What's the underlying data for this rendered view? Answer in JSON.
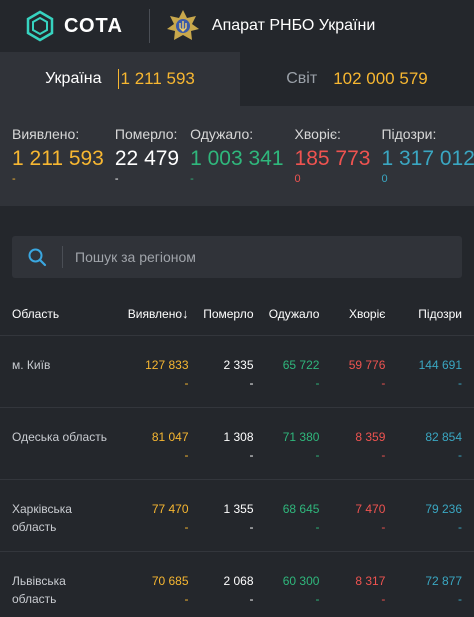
{
  "header": {
    "logo_text": "СОТА",
    "org_name": "Апарат РНБО України"
  },
  "tabs": [
    {
      "label": "Україна",
      "value": "1 211 593"
    },
    {
      "label": "Світ",
      "value": "102 000 579"
    }
  ],
  "summary": [
    {
      "label": "Виявлено:",
      "value": "1 211 593",
      "delta": "-"
    },
    {
      "label": "Померло:",
      "value": "22 479",
      "delta": "-"
    },
    {
      "label": "Одужало:",
      "value": "1 003 341",
      "delta": "-"
    },
    {
      "label": "Хворіє:",
      "value": "185 773",
      "delta": "0"
    },
    {
      "label": "Підозри:",
      "value": "1 317 012",
      "delta": "0"
    }
  ],
  "search": {
    "placeholder": "Пошук за регіоном"
  },
  "table": {
    "headers": [
      "Область",
      "Виявлено",
      "Померло",
      "Одужало",
      "Хворіє",
      "Підозри"
    ],
    "sort_arrow": "↓",
    "rows": [
      {
        "region": "м. Київ",
        "values": [
          "127 833",
          "2 335",
          "65 722",
          "59 776",
          "144 691"
        ],
        "deltas": [
          "-",
          "-",
          "-",
          "-",
          "-"
        ]
      },
      {
        "region": "Одеська область",
        "values": [
          "81 047",
          "1 308",
          "71 380",
          "8 359",
          "82 854"
        ],
        "deltas": [
          "-",
          "-",
          "-",
          "-",
          "-"
        ]
      },
      {
        "region": "Харківська область",
        "values": [
          "77 470",
          "1 355",
          "68 645",
          "7 470",
          "79 236"
        ],
        "deltas": [
          "-",
          "-",
          "-",
          "-",
          "-"
        ]
      },
      {
        "region": "Львівська область",
        "values": [
          "70 685",
          "2 068",
          "60 300",
          "8 317",
          "72 877"
        ],
        "deltas": [
          "-",
          "-",
          "-",
          "-",
          "-"
        ]
      }
    ]
  },
  "colors": {
    "confirmed": "#f7b731",
    "deaths": "#ffffff",
    "recovered": "#2fb77c",
    "sick": "#ef5350",
    "suspected": "#3aa7c2"
  },
  "icons": {
    "logo": "sota-logo-icon",
    "emblem": "rnbo-emblem-icon",
    "search": "search-icon"
  }
}
